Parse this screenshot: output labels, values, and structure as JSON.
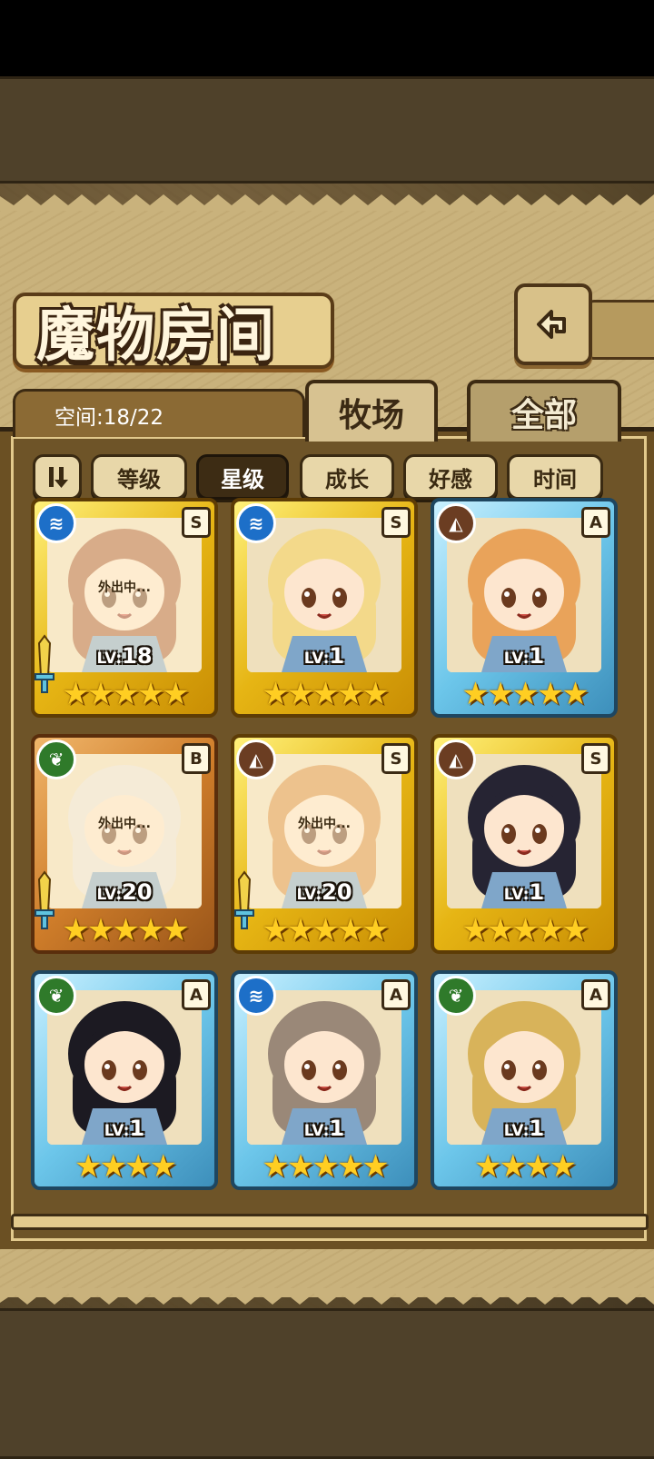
{
  "header": {
    "title": "魔物房间"
  },
  "capacity": {
    "label": "空间:18/22"
  },
  "tabs": [
    {
      "label": "牧场",
      "active": true
    },
    {
      "label": "全部",
      "active": false
    }
  ],
  "sort": {
    "order_icon": "sort-order-icon",
    "options": [
      {
        "label": "等级",
        "active": false
      },
      {
        "label": "星级",
        "active": true
      },
      {
        "label": "成长",
        "active": false
      },
      {
        "label": "好感",
        "active": false
      },
      {
        "label": "时间",
        "active": false
      }
    ]
  },
  "monsters": [
    {
      "level_prefix": "LV:",
      "level": "18",
      "rank": "S",
      "element": "water",
      "stars": "★★★★★",
      "away_text": "外出中...",
      "frame": "gold"
    },
    {
      "level_prefix": "LV:",
      "level": "1",
      "rank": "S",
      "element": "water",
      "stars": "★★★★★",
      "away_text": "",
      "frame": "gold"
    },
    {
      "level_prefix": "LV:",
      "level": "1",
      "rank": "A",
      "element": "earth",
      "stars": "★★★★★",
      "away_text": "",
      "frame": "blue"
    },
    {
      "level_prefix": "LV:",
      "level": "20",
      "rank": "B",
      "element": "leaf",
      "stars": "★★★★★",
      "away_text": "外出中...",
      "frame": "bronze"
    },
    {
      "level_prefix": "LV:",
      "level": "20",
      "rank": "S",
      "element": "earth",
      "stars": "★★★★★",
      "away_text": "外出中...",
      "frame": "gold"
    },
    {
      "level_prefix": "LV:",
      "level": "1",
      "rank": "S",
      "element": "earth",
      "stars": "★★★★★",
      "away_text": "",
      "frame": "gold"
    },
    {
      "level_prefix": "LV:",
      "level": "1",
      "rank": "A",
      "element": "leaf",
      "stars": "★★★★",
      "away_text": "",
      "frame": "blue"
    },
    {
      "level_prefix": "LV:",
      "level": "1",
      "rank": "A",
      "element": "water",
      "stars": "★★★★★",
      "away_text": "",
      "frame": "blue"
    },
    {
      "level_prefix": "LV:",
      "level": "1",
      "rank": "A",
      "element": "leaf",
      "stars": "★★★★",
      "away_text": "",
      "frame": "blue"
    }
  ],
  "colors": {
    "water": "#1d6fc8",
    "earth": "#6b3d22",
    "leaf": "#2f7a2a",
    "star": "#ffce22"
  }
}
